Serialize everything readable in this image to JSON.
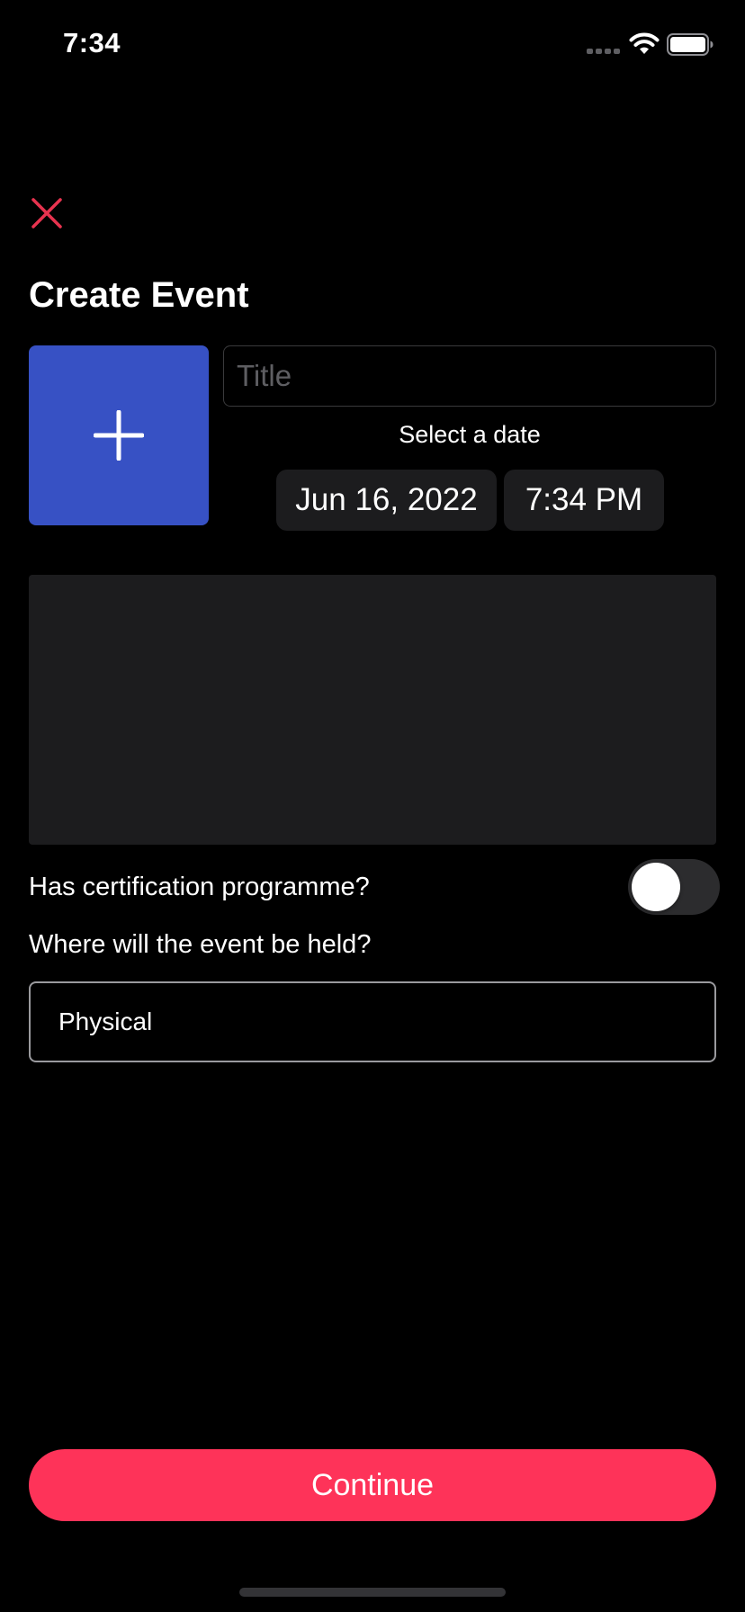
{
  "status_bar": {
    "time": "7:34"
  },
  "header": {
    "title": "Create Event"
  },
  "form": {
    "title_placeholder": "Title",
    "title_value": "",
    "date_section_label": "Select a date",
    "date_value": "Jun 16, 2022",
    "time_value": "7:34 PM",
    "description_value": "",
    "certification_label": "Has certification programme?",
    "certification_enabled": false,
    "location_label": "Where will the event be held?",
    "location_value": "Physical"
  },
  "footer": {
    "continue_label": "Continue"
  },
  "colors": {
    "accent": "#fe3359",
    "image_picker": "#3751c4",
    "close_icon": "#e8334f",
    "surface": "#1c1c1e",
    "background": "#000000"
  },
  "icons": {
    "close": "close-icon",
    "add_image": "plus-icon",
    "signal": "cellular-signal-icon",
    "wifi": "wifi-icon",
    "battery": "battery-icon"
  }
}
